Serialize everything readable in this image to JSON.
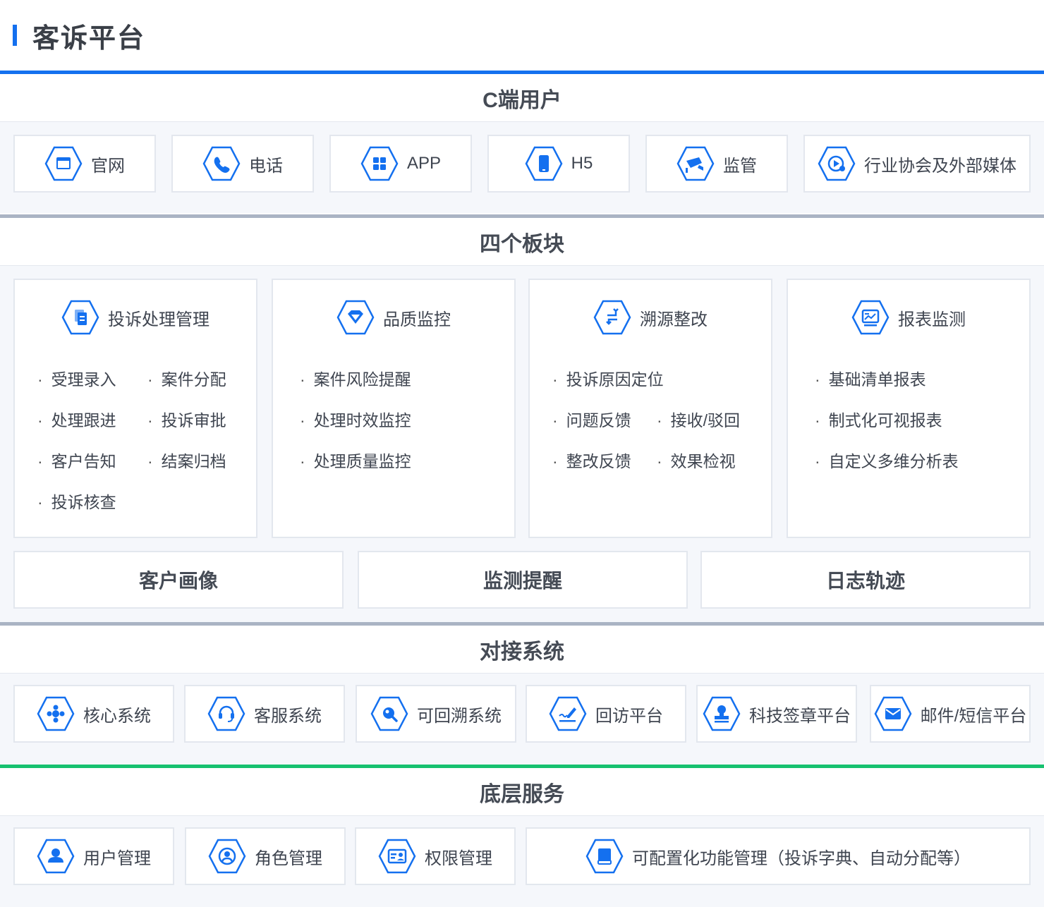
{
  "page": {
    "title": "客诉平台"
  },
  "sections": {
    "c_users": {
      "title": "C端用户",
      "items": [
        {
          "label": "官网",
          "icon": "browser-window-icon"
        },
        {
          "label": "电话",
          "icon": "phone-icon"
        },
        {
          "label": "APP",
          "icon": "app-grid-icon"
        },
        {
          "label": "H5",
          "icon": "mobile-icon"
        },
        {
          "label": "监管",
          "icon": "camera-surveillance-icon"
        },
        {
          "label": "行业协会及外部媒体",
          "icon": "media-play-icon"
        }
      ]
    },
    "four_blocks": {
      "title": "四个板块",
      "panels": [
        {
          "title": "投诉处理管理",
          "icon": "documents-icon",
          "items": [
            "受理录入",
            "案件分配",
            "处理跟进",
            "投诉审批",
            "客户告知",
            "结案归档",
            "投诉核查"
          ]
        },
        {
          "title": "品质监控",
          "icon": "diamond-icon",
          "items": [
            "案件风险提醒",
            "处理时效监控",
            "处理质量监控"
          ]
        },
        {
          "title": "溯源整改",
          "icon": "exchange-arrows-icon",
          "items": [
            "投诉原因定位",
            "问题反馈",
            "接收/驳回",
            "整改反馈",
            "效果检视"
          ]
        },
        {
          "title": "报表监测",
          "icon": "report-chart-icon",
          "items": [
            "基础清单报表",
            "制式化可视报表",
            "自定义多维分析表"
          ]
        }
      ],
      "extras": [
        "客户画像",
        "监测提醒",
        "日志轨迹"
      ]
    },
    "integration": {
      "title": "对接系统",
      "items": [
        {
          "label": "核心系统",
          "icon": "core-cluster-icon"
        },
        {
          "label": "客服系统",
          "icon": "headset-icon"
        },
        {
          "label": "可回溯系统",
          "icon": "search-magnifier-icon"
        },
        {
          "label": "回访平台",
          "icon": "signature-pen-icon"
        },
        {
          "label": "科技签章平台",
          "icon": "stamp-seal-icon"
        },
        {
          "label": "邮件/短信平台",
          "icon": "envelope-icon"
        }
      ]
    },
    "base": {
      "title": "底层服务",
      "items": [
        {
          "label": "用户管理",
          "icon": "user-icon"
        },
        {
          "label": "角色管理",
          "icon": "user-circle-icon"
        },
        {
          "label": "权限管理",
          "icon": "id-card-icon"
        },
        {
          "label": "可配置化功能管理（投诉字典、自动分配等）",
          "icon": "book-icon"
        }
      ]
    }
  },
  "colors": {
    "accent": "#1470ef",
    "divider_gray": "#aab4c4",
    "divider_green": "#17c16f",
    "card_border": "#e3e7ee",
    "background": "#f5f7fb"
  }
}
